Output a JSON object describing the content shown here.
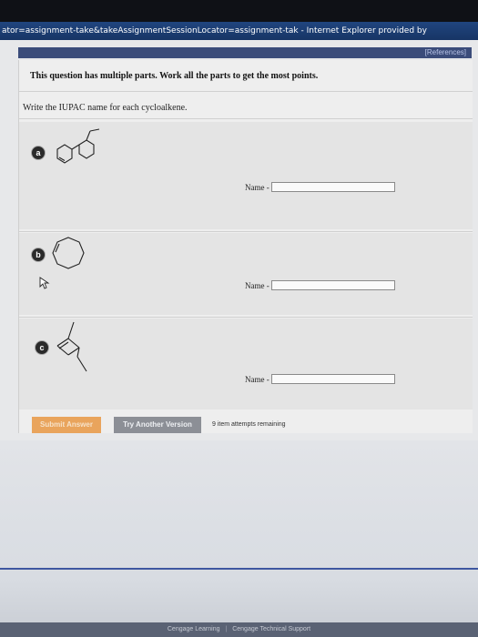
{
  "window": {
    "title": "ator=assignment-take&takeAssignmentSessionLocator=assignment-tak - Internet Explorer provided by"
  },
  "references_link": "[References]",
  "question": {
    "heading": "This question has multiple parts. Work all the parts to get the most points.",
    "instruction": "Write the IUPAC name for each cycloalkene.",
    "parts": [
      {
        "letter": "a",
        "name_label": "Name -",
        "name_value": ""
      },
      {
        "letter": "b",
        "name_label": "Name -",
        "name_value": ""
      },
      {
        "letter": "c",
        "name_label": "Name -",
        "name_value": ""
      }
    ]
  },
  "actions": {
    "submit_label": "Submit Answer",
    "try_label": "Try Another Version",
    "attempts_text": "9 item attempts remaining"
  },
  "footer": {
    "left": "Cengage Learning",
    "separator": "|",
    "right": "Cengage Technical Support"
  },
  "colors": {
    "submit_button": "#e9a45c",
    "try_button": "#8c8f96",
    "titlebar": "#20457f"
  }
}
